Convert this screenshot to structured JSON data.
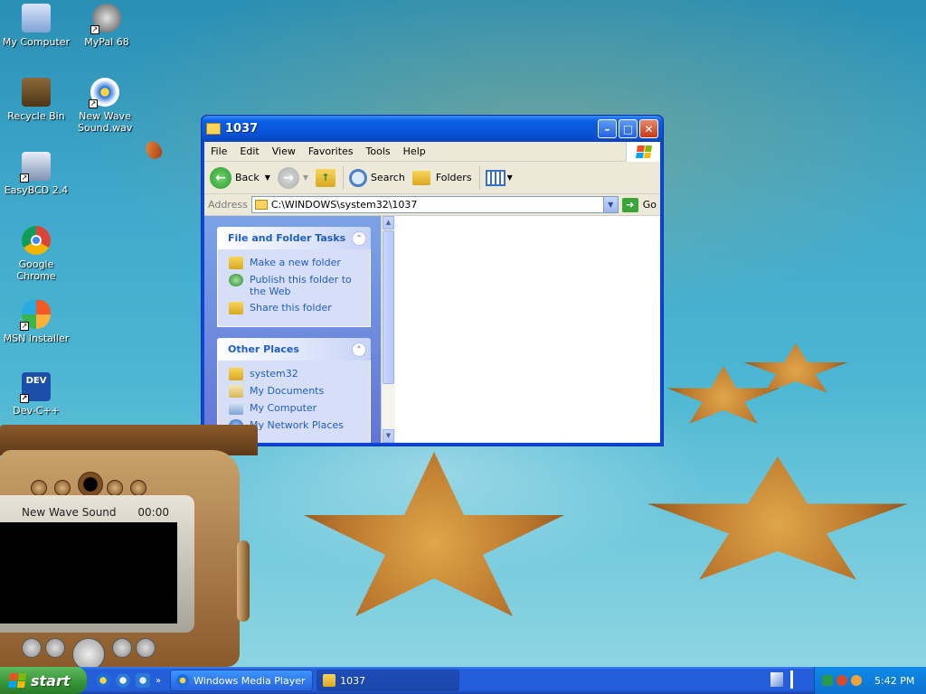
{
  "desktop": {
    "icons": [
      {
        "label": "My Computer"
      },
      {
        "label": "MyPal 68"
      },
      {
        "label": "Recycle Bin"
      },
      {
        "label": "New Wave Sound.wav"
      },
      {
        "label": "EasyBCD 2.4"
      },
      {
        "label": "Google Chrome"
      },
      {
        "label": "MSN Installer"
      },
      {
        "label": "Dev-C++"
      }
    ]
  },
  "explorer": {
    "title": "1037",
    "menu": [
      "File",
      "Edit",
      "View",
      "Favorites",
      "Tools",
      "Help"
    ],
    "toolbar": {
      "back": "Back",
      "search": "Search",
      "folders": "Folders"
    },
    "address": {
      "label": "Address",
      "value": "C:\\WINDOWS\\system32\\1037",
      "go": "Go"
    },
    "tasks": {
      "title": "File and Folder Tasks",
      "items": [
        "Make a new folder",
        "Publish this folder to the Web",
        "Share this folder"
      ]
    },
    "other_places": {
      "title": "Other Places",
      "items": [
        "system32",
        "My Documents",
        "My Computer",
        "My Network Places"
      ]
    }
  },
  "media_player": {
    "track": "New Wave Sound",
    "time": "00:00"
  },
  "taskbar": {
    "start": "start",
    "tasks": [
      {
        "label": "Windows Media Player"
      },
      {
        "label": "1037"
      }
    ],
    "clock": "5:42 PM"
  },
  "colors": {
    "taskbar": "#245edb",
    "start": "#379337",
    "titlebar": "#0852d6",
    "link": "#215dc6"
  }
}
